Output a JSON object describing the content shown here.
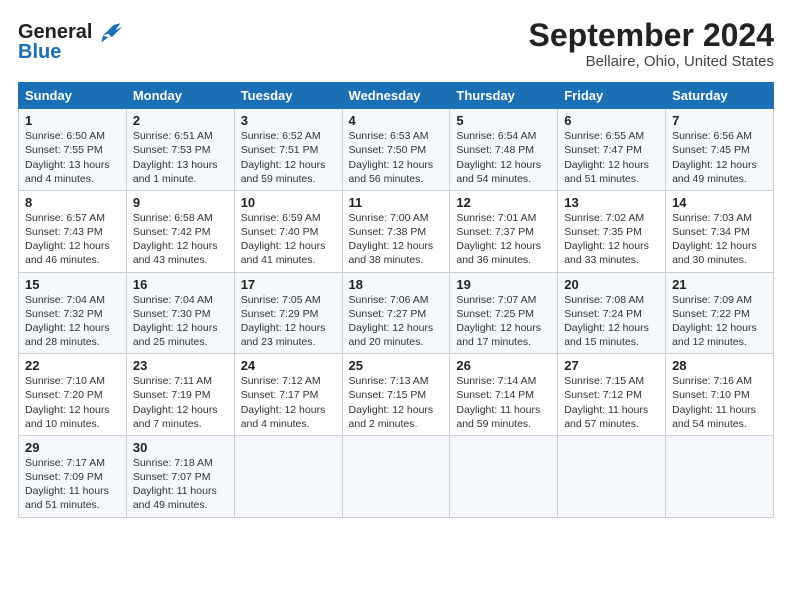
{
  "logo": {
    "text_general": "General",
    "text_blue": "Blue"
  },
  "title": "September 2024",
  "subtitle": "Bellaire, Ohio, United States",
  "columns": [
    "Sunday",
    "Monday",
    "Tuesday",
    "Wednesday",
    "Thursday",
    "Friday",
    "Saturday"
  ],
  "rows": [
    [
      {
        "day": "1",
        "sunrise": "Sunrise: 6:50 AM",
        "sunset": "Sunset: 7:55 PM",
        "daylight": "Daylight: 13 hours and 4 minutes."
      },
      {
        "day": "2",
        "sunrise": "Sunrise: 6:51 AM",
        "sunset": "Sunset: 7:53 PM",
        "daylight": "Daylight: 13 hours and 1 minute."
      },
      {
        "day": "3",
        "sunrise": "Sunrise: 6:52 AM",
        "sunset": "Sunset: 7:51 PM",
        "daylight": "Daylight: 12 hours and 59 minutes."
      },
      {
        "day": "4",
        "sunrise": "Sunrise: 6:53 AM",
        "sunset": "Sunset: 7:50 PM",
        "daylight": "Daylight: 12 hours and 56 minutes."
      },
      {
        "day": "5",
        "sunrise": "Sunrise: 6:54 AM",
        "sunset": "Sunset: 7:48 PM",
        "daylight": "Daylight: 12 hours and 54 minutes."
      },
      {
        "day": "6",
        "sunrise": "Sunrise: 6:55 AM",
        "sunset": "Sunset: 7:47 PM",
        "daylight": "Daylight: 12 hours and 51 minutes."
      },
      {
        "day": "7",
        "sunrise": "Sunrise: 6:56 AM",
        "sunset": "Sunset: 7:45 PM",
        "daylight": "Daylight: 12 hours and 49 minutes."
      }
    ],
    [
      {
        "day": "8",
        "sunrise": "Sunrise: 6:57 AM",
        "sunset": "Sunset: 7:43 PM",
        "daylight": "Daylight: 12 hours and 46 minutes."
      },
      {
        "day": "9",
        "sunrise": "Sunrise: 6:58 AM",
        "sunset": "Sunset: 7:42 PM",
        "daylight": "Daylight: 12 hours and 43 minutes."
      },
      {
        "day": "10",
        "sunrise": "Sunrise: 6:59 AM",
        "sunset": "Sunset: 7:40 PM",
        "daylight": "Daylight: 12 hours and 41 minutes."
      },
      {
        "day": "11",
        "sunrise": "Sunrise: 7:00 AM",
        "sunset": "Sunset: 7:38 PM",
        "daylight": "Daylight: 12 hours and 38 minutes."
      },
      {
        "day": "12",
        "sunrise": "Sunrise: 7:01 AM",
        "sunset": "Sunset: 7:37 PM",
        "daylight": "Daylight: 12 hours and 36 minutes."
      },
      {
        "day": "13",
        "sunrise": "Sunrise: 7:02 AM",
        "sunset": "Sunset: 7:35 PM",
        "daylight": "Daylight: 12 hours and 33 minutes."
      },
      {
        "day": "14",
        "sunrise": "Sunrise: 7:03 AM",
        "sunset": "Sunset: 7:34 PM",
        "daylight": "Daylight: 12 hours and 30 minutes."
      }
    ],
    [
      {
        "day": "15",
        "sunrise": "Sunrise: 7:04 AM",
        "sunset": "Sunset: 7:32 PM",
        "daylight": "Daylight: 12 hours and 28 minutes."
      },
      {
        "day": "16",
        "sunrise": "Sunrise: 7:04 AM",
        "sunset": "Sunset: 7:30 PM",
        "daylight": "Daylight: 12 hours and 25 minutes."
      },
      {
        "day": "17",
        "sunrise": "Sunrise: 7:05 AM",
        "sunset": "Sunset: 7:29 PM",
        "daylight": "Daylight: 12 hours and 23 minutes."
      },
      {
        "day": "18",
        "sunrise": "Sunrise: 7:06 AM",
        "sunset": "Sunset: 7:27 PM",
        "daylight": "Daylight: 12 hours and 20 minutes."
      },
      {
        "day": "19",
        "sunrise": "Sunrise: 7:07 AM",
        "sunset": "Sunset: 7:25 PM",
        "daylight": "Daylight: 12 hours and 17 minutes."
      },
      {
        "day": "20",
        "sunrise": "Sunrise: 7:08 AM",
        "sunset": "Sunset: 7:24 PM",
        "daylight": "Daylight: 12 hours and 15 minutes."
      },
      {
        "day": "21",
        "sunrise": "Sunrise: 7:09 AM",
        "sunset": "Sunset: 7:22 PM",
        "daylight": "Daylight: 12 hours and 12 minutes."
      }
    ],
    [
      {
        "day": "22",
        "sunrise": "Sunrise: 7:10 AM",
        "sunset": "Sunset: 7:20 PM",
        "daylight": "Daylight: 12 hours and 10 minutes."
      },
      {
        "day": "23",
        "sunrise": "Sunrise: 7:11 AM",
        "sunset": "Sunset: 7:19 PM",
        "daylight": "Daylight: 12 hours and 7 minutes."
      },
      {
        "day": "24",
        "sunrise": "Sunrise: 7:12 AM",
        "sunset": "Sunset: 7:17 PM",
        "daylight": "Daylight: 12 hours and 4 minutes."
      },
      {
        "day": "25",
        "sunrise": "Sunrise: 7:13 AM",
        "sunset": "Sunset: 7:15 PM",
        "daylight": "Daylight: 12 hours and 2 minutes."
      },
      {
        "day": "26",
        "sunrise": "Sunrise: 7:14 AM",
        "sunset": "Sunset: 7:14 PM",
        "daylight": "Daylight: 11 hours and 59 minutes."
      },
      {
        "day": "27",
        "sunrise": "Sunrise: 7:15 AM",
        "sunset": "Sunset: 7:12 PM",
        "daylight": "Daylight: 11 hours and 57 minutes."
      },
      {
        "day": "28",
        "sunrise": "Sunrise: 7:16 AM",
        "sunset": "Sunset: 7:10 PM",
        "daylight": "Daylight: 11 hours and 54 minutes."
      }
    ],
    [
      {
        "day": "29",
        "sunrise": "Sunrise: 7:17 AM",
        "sunset": "Sunset: 7:09 PM",
        "daylight": "Daylight: 11 hours and 51 minutes."
      },
      {
        "day": "30",
        "sunrise": "Sunrise: 7:18 AM",
        "sunset": "Sunset: 7:07 PM",
        "daylight": "Daylight: 11 hours and 49 minutes."
      },
      null,
      null,
      null,
      null,
      null
    ]
  ]
}
